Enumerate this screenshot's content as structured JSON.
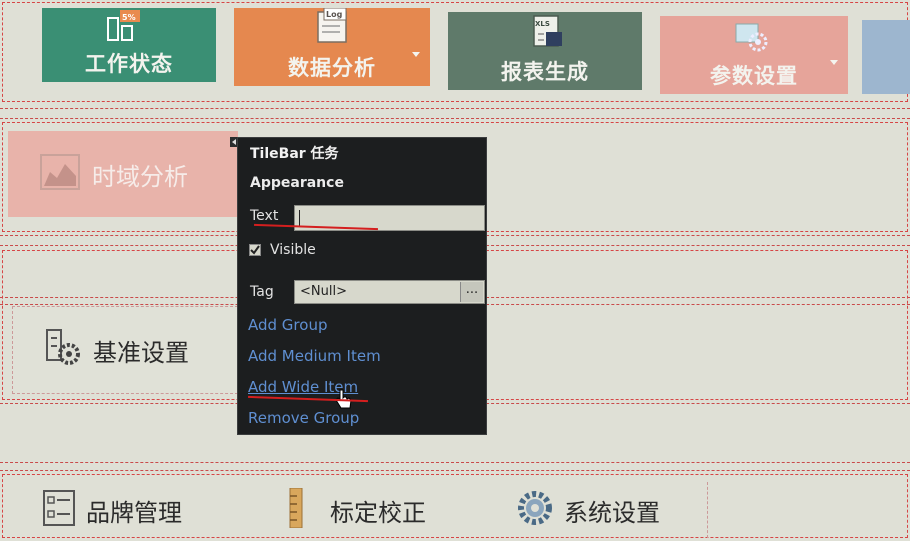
{
  "top_tiles": [
    {
      "label": "工作状态",
      "icon": "battery-gauge-icon",
      "badge": "5%"
    },
    {
      "label": "数据分析",
      "icon": "log-file-icon",
      "badge": "Log"
    },
    {
      "label": "报表生成",
      "icon": "xls-report-icon",
      "badge": "XLS"
    },
    {
      "label": "参数设置",
      "icon": "settings-gear-icon"
    }
  ],
  "group1": {
    "tile_label": "时域分析",
    "icon": "area-chart-icon"
  },
  "group2": {
    "tile_label": "基准设置",
    "icon": "gear-settings-icon"
  },
  "bottom_tiles": [
    {
      "label": "品牌管理",
      "icon": "checklist-icon"
    },
    {
      "label": "标定校正",
      "icon": "ruler-icon"
    },
    {
      "label": "系统设置",
      "icon": "gear-icon"
    }
  ],
  "panel": {
    "title": "TileBar 任务",
    "section": "Appearance",
    "text_label": "Text",
    "text_value": "",
    "visible_label": "Visible",
    "visible_checked": true,
    "tag_label": "Tag",
    "tag_value": "<Null>",
    "tag_button": "...",
    "actions": [
      "Add Group",
      "Add Medium Item",
      "Add Wide Item",
      "Remove Group"
    ]
  },
  "colors": {
    "teal": "#3a8f74",
    "orange": "#e5884f",
    "green": "#5f7a6a",
    "pink": "#e6a49a",
    "link": "#5f8fd1"
  }
}
